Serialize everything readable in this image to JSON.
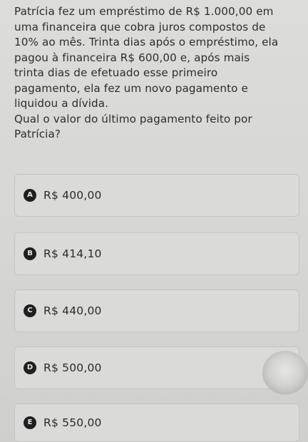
{
  "question": {
    "lines": [
      "Patrícia fez um empréstimo de R$ 1.000,00 em",
      "uma financeira que cobra juros compostos de",
      "10% ao mês. Trinta dias após o empréstimo, ela",
      "pagou à financeira R$ 600,00 e, após mais",
      "trinta dias de efetuado esse primeiro",
      "pagamento, ela fez um novo pagamento e",
      "liquidou a dívida.",
      "Qual o valor do último pagamento feito por",
      "Patrícia?"
    ]
  },
  "options": [
    {
      "letter": "A",
      "text": "R$ 400,00"
    },
    {
      "letter": "B",
      "text": "R$ 414,10"
    },
    {
      "letter": "C",
      "text": "R$ 440,00"
    },
    {
      "letter": "D",
      "text": "R$ 500,00"
    },
    {
      "letter": "E",
      "text": "R$ 550,00"
    }
  ]
}
